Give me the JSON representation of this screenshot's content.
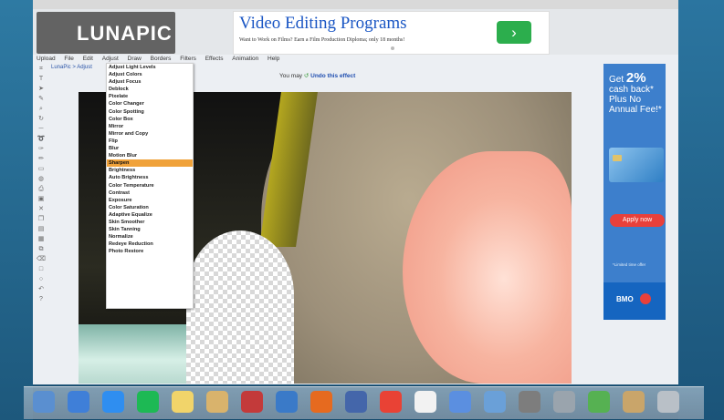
{
  "header": {
    "logo_text": "LUNAPIC",
    "ad": {
      "title": "Video Editing Programs",
      "subtitle": "Want to Work on Films? Earn a Film Production Diploma; only 18 months!",
      "go_label": "›"
    }
  },
  "menubar": [
    "Upload",
    "File",
    "Edit",
    "Adjust",
    "Draw",
    "Borders",
    "Filters",
    "Effects",
    "Animation",
    "Help"
  ],
  "breadcrumb": "LunaPic > Adjust",
  "notice": {
    "prefix": "You may",
    "undo_label": "Undo this effect"
  },
  "adjust_menu": {
    "items": [
      "Adjust Light Levels",
      "Adjust Colors",
      "Adjust Focus",
      "Deblock",
      "Pixelate",
      "Color Changer",
      "Color Spotting",
      "Color Box",
      "Mirror",
      "Mirror and Copy",
      "Flip",
      "Blur",
      "Motion Blur",
      "Sharpen",
      "Brightness",
      "Auto Brightness",
      "Color Temperature",
      "Contrast",
      "Exposure",
      "Color Saturation",
      "Adaptive Equalize",
      "Skin Smoother",
      "Skin Tanning",
      "Normalize",
      "Redeye Reduction",
      "Photo Restore"
    ],
    "active_item": "Sharpen"
  },
  "side_ad": {
    "line1": "Get",
    "highlight": "2%",
    "line2": "cash back*",
    "line3": "Plus No",
    "line4": "Annual Fee!*",
    "apply_label": "Apply now",
    "note": "*Limited time offer",
    "brand": "BMO"
  },
  "dock": {
    "icons": [
      "finder-icon",
      "safari-icon",
      "appstore-icon",
      "spotify-icon",
      "notes-icon",
      "folder-icon",
      "photo-icon",
      "image-editor-icon",
      "firefox-icon",
      "pen-icon",
      "chrome-icon",
      "calendar-icon",
      "network-icon",
      "preview-icon",
      "app-icon",
      "settings-icon",
      "evernote-icon",
      "photos-icon",
      "trash-icon"
    ]
  }
}
